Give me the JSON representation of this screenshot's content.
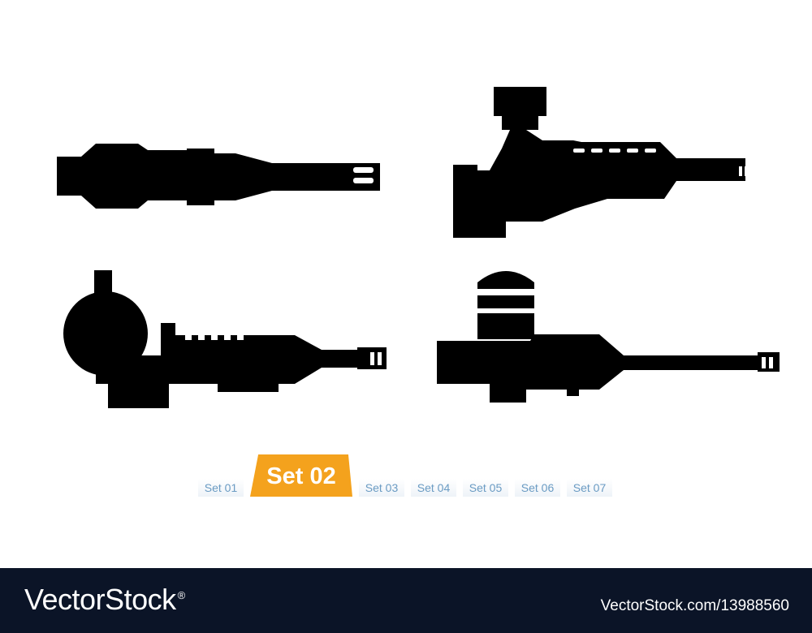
{
  "illustration": {
    "guns": [
      {
        "name": "gun-1",
        "icon": "gun-turret-silhouette"
      },
      {
        "name": "gun-2",
        "icon": "gun-turret-silhouette"
      },
      {
        "name": "gun-3",
        "icon": "gun-turret-silhouette"
      },
      {
        "name": "gun-4",
        "icon": "gun-turret-silhouette"
      }
    ],
    "fill": "#000000"
  },
  "tabs": [
    {
      "label": "Set 01",
      "active": false
    },
    {
      "label": "Set 02",
      "active": true
    },
    {
      "label": "Set 03",
      "active": false
    },
    {
      "label": "Set 04",
      "active": false
    },
    {
      "label": "Set 05",
      "active": false
    },
    {
      "label": "Set 06",
      "active": false
    },
    {
      "label": "Set 07",
      "active": false
    }
  ],
  "colors": {
    "accent": "#f4a21d",
    "tab_text": "#6a9bc3",
    "footer_bg": "#0b1427"
  },
  "footer": {
    "logo": "VectorStock",
    "logo_mark": "®",
    "reference": "VectorStock.com/13988560"
  }
}
